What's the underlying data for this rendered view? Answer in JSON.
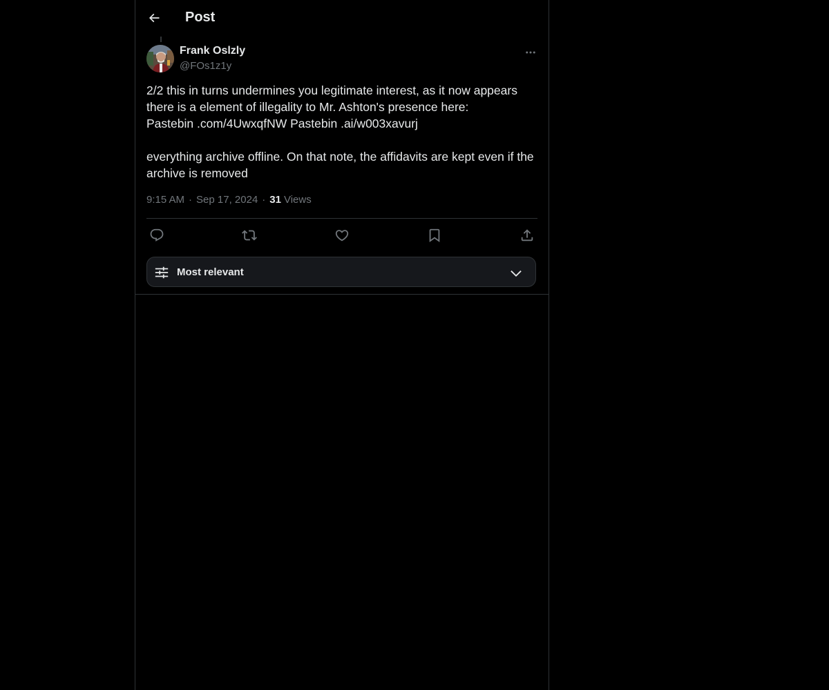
{
  "header": {
    "title": "Post",
    "back_icon": "arrow-left-icon"
  },
  "post": {
    "author": {
      "name": "Frank Oslzly",
      "handle": "@FOs1z1y"
    },
    "text": "2/2 this in turns undermines you legitimate interest, as it now appears there is a element of illegality to Mr. Ashton's presence here:\nPastebin .com/4UwxqfNW Pastebin .ai/w003xavurj\n\neverything archive offline. On that note, the affidavits are kept even if the archive is removed",
    "time": "9:15 AM",
    "date": "Sep 17, 2024",
    "separator": "·",
    "views_count": "31",
    "views_label": "Views"
  },
  "actions": [
    {
      "name": "reply",
      "icon": "reply-icon"
    },
    {
      "name": "repost",
      "icon": "repost-icon"
    },
    {
      "name": "like",
      "icon": "heart-icon"
    },
    {
      "name": "bookmark",
      "icon": "bookmark-icon"
    },
    {
      "name": "share",
      "icon": "share-icon"
    }
  ],
  "sort": {
    "label": "Most relevant",
    "icon": "sliders-icon",
    "chevron": "chevron-down-icon"
  },
  "colors": {
    "background": "#000000",
    "text_primary": "#e7e9ea",
    "text_secondary": "#71767b",
    "border": "#2f3336",
    "sort_bg": "#16181c"
  }
}
